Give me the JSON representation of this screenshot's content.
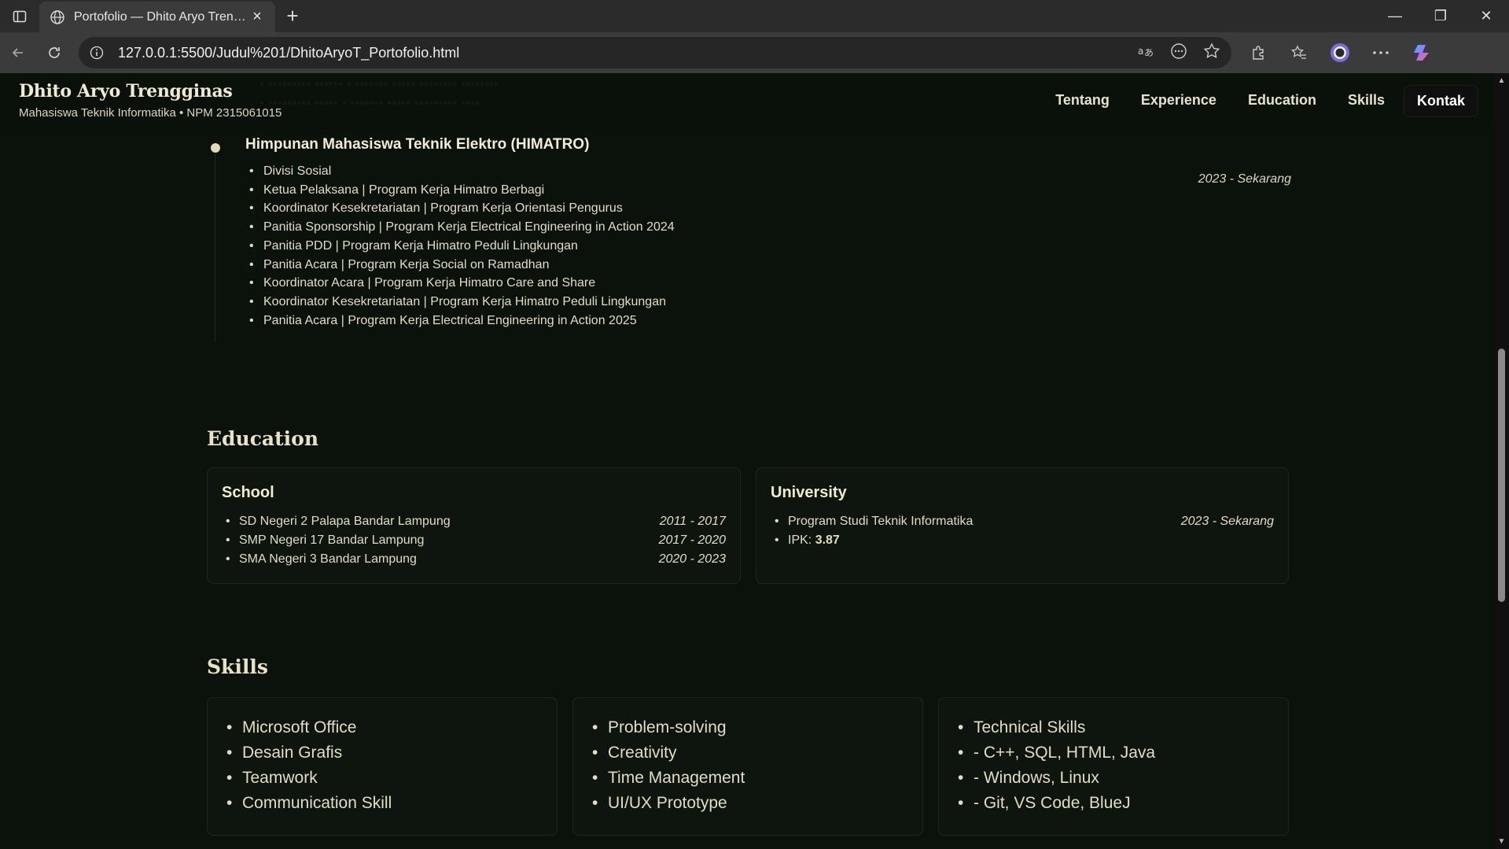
{
  "browser": {
    "tab_title": "Portofolio — Dhito Aryo Trengginas",
    "url": "127.0.0.1:5500/Judul%201/DhitoAryoT_Portofolio.html"
  },
  "header": {
    "name": "Dhito Aryo Trengginas",
    "subtitle": "Mahasiswa Teknik Informatika • NPM 2315061015",
    "nav": [
      "Tentang",
      "Experience",
      "Education",
      "Skills",
      "Kontak"
    ]
  },
  "org": {
    "title": "Himpunan Mahasiswa Teknik Elektro (HIMATRO)",
    "period": "2023 - Sekarang",
    "items": [
      "Divisi Sosial",
      "Ketua Pelaksana | Program Kerja Himatro Berbagi",
      "Koordinator Kesekretariatan | Program Kerja Orientasi Pengurus",
      "Panitia Sponsorship | Program Kerja Electrical Engineering in Action 2024",
      "Panitia PDD | Program Kerja Himatro Peduli Lingkungan",
      "Panitia Acara | Program Kerja Social on Ramadhan",
      "Koordinator Acara | Program Kerja Himatro Care and Share",
      "Koordinator Kesekretariatan | Program Kerja Himatro Peduli Lingkungan",
      "Panitia Acara | Program Kerja Electrical Engineering in Action 2025"
    ]
  },
  "education": {
    "title": "Education",
    "school": {
      "heading": "School",
      "rows": [
        {
          "name": "SD Negeri 2 Palapa Bandar Lampung",
          "years": "2011 - 2017"
        },
        {
          "name": "SMP Negeri 17 Bandar Lampung",
          "years": "2017 - 2020"
        },
        {
          "name": "SMA Negeri 3 Bandar Lampung",
          "years": "2020 - 2023"
        }
      ]
    },
    "university": {
      "heading": "University",
      "program": "Program Studi Teknik Informatika",
      "years": "2023 - Sekarang",
      "ipk_label": "IPK: ",
      "ipk_value": "3.87"
    }
  },
  "skills": {
    "title": "Skills",
    "col1": [
      "Microsoft Office",
      "Desain Grafis",
      "Teamwork",
      "Communication Skill"
    ],
    "col2": [
      "Problem-solving",
      "Creativity",
      "Time Management",
      "UI/UX Prototype"
    ],
    "col3": [
      "Technical Skills",
      "- C++, SQL, HTML, Java",
      "- Windows, Linux",
      "- Git, VS Code, BlueJ"
    ]
  }
}
